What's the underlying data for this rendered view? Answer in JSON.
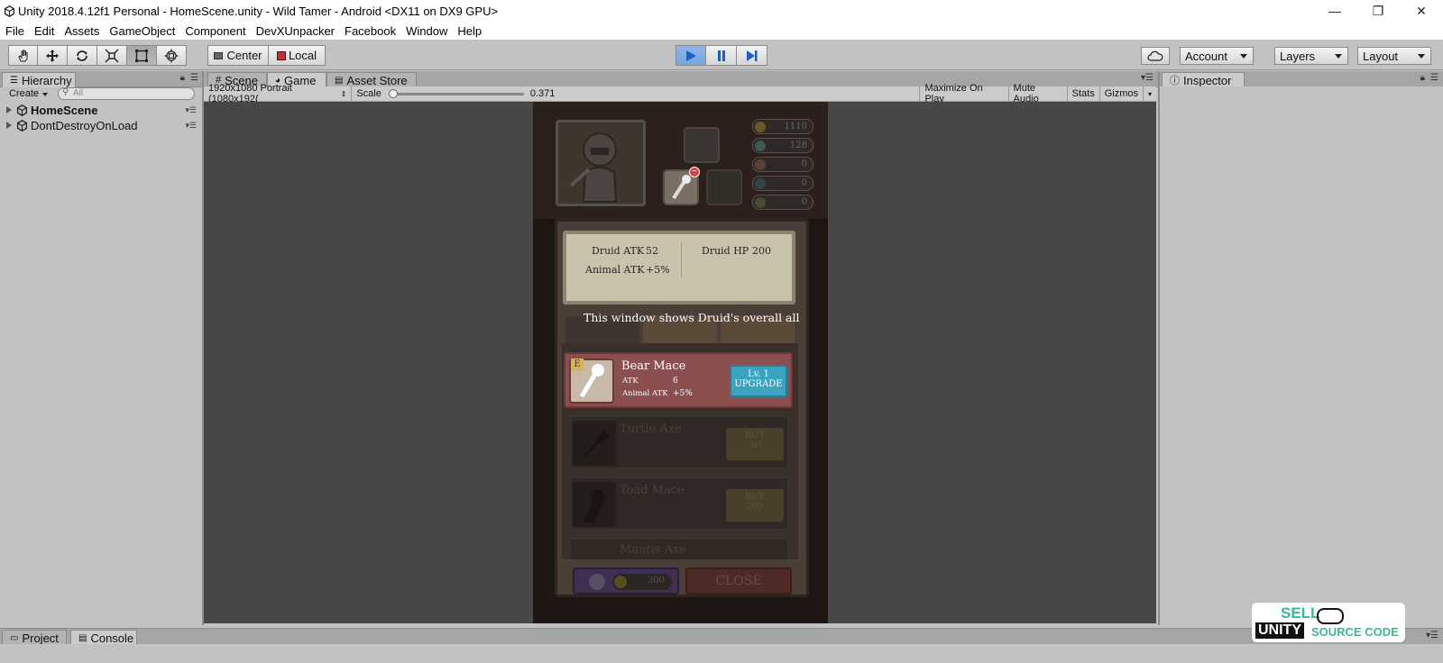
{
  "window": {
    "title": "Unity 2018.4.12f1 Personal - HomeScene.unity - Wild Tamer - Android <DX11 on DX9 GPU>",
    "minimize_glyph": "—",
    "restore_glyph": "❐",
    "close_glyph": "✕"
  },
  "menu": [
    "File",
    "Edit",
    "Assets",
    "GameObject",
    "Component",
    "DevXUnpacker",
    "Facebook",
    "Window",
    "Help"
  ],
  "toolbar": {
    "pivot": "Center",
    "space": "Local",
    "account": "Account",
    "layers": "Layers",
    "layout": "Layout"
  },
  "hierarchy": {
    "tab": "Hierarchy",
    "create": "Create",
    "search_placeholder": "All",
    "items": [
      "HomeScene",
      "DontDestroyOnLoad"
    ]
  },
  "center_tabs": {
    "scene": "Scene",
    "game": "Game",
    "asset_store": "Asset Store"
  },
  "game_toolbar": {
    "resolution": "1920x1080 Portrait (1080x192(",
    "scale_label": "Scale",
    "scale_value": "0.371",
    "scale_fraction": 0.0,
    "maximize": "Maximize On Play",
    "mute": "Mute Audio",
    "stats": "Stats",
    "gizmos": "Gizmos"
  },
  "inspector": {
    "tab": "Inspector"
  },
  "game": {
    "currencies": [
      "1110",
      "128",
      "0",
      "0",
      "0"
    ],
    "stats": {
      "druid_atk_label": "Druid ATK",
      "druid_atk": "52",
      "druid_hp_label": "Druid HP",
      "druid_hp": "200",
      "animal_atk_label": "Animal ATK",
      "animal_atk": "+5%"
    },
    "tooltip": "This window shows Druid's overall all",
    "items": [
      {
        "name": "Bear Mace",
        "stat1_label": "ATK",
        "stat1": "6",
        "stat2_label": "Animal ATK",
        "stat2": "+5%",
        "badge": "E",
        "btn_line1": "Lv. 1",
        "btn_line2": "UPGRADE"
      },
      {
        "name": "Turtle Axe",
        "btn_line1": "BUY",
        "btn_line2": "50"
      },
      {
        "name": "Toad Mace",
        "btn_line1": "BUY",
        "btn_line2": "200"
      },
      {
        "name": "Mantis Axe"
      }
    ],
    "ad_cost": "300",
    "close": "CLOSE"
  },
  "bottom": {
    "project": "Project",
    "console": "Console"
  },
  "watermark": {
    "line1": "SELL",
    "line2": "UNITY",
    "line3": "SOURCE CODE"
  }
}
